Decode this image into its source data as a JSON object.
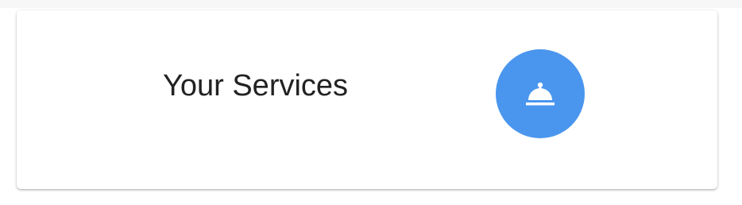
{
  "card": {
    "title": "Your Services",
    "icon": "room-service-bell-icon",
    "accent_color": "#4a96ee",
    "icon_color": "#ffffff"
  }
}
